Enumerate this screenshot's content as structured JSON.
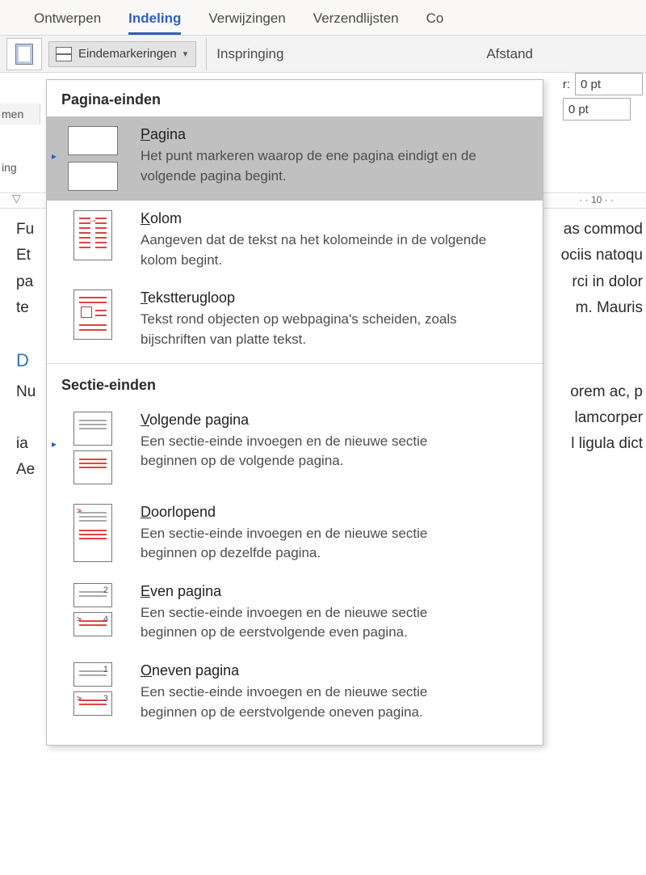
{
  "tabs": {
    "ontwerpen": "Ontwerpen",
    "indeling": "Indeling",
    "verwijzingen": "Verwijzingen",
    "verzendlijsten": "Verzendlijsten",
    "co_fragment": "Co"
  },
  "ribbon": {
    "breaksButton": "Eindemarkeringen",
    "groupIndent": "Inspringing",
    "groupSpacing": "Afstand",
    "spacingLabel": "r:",
    "spacingBefore": "0 pt",
    "spacingAfter": "0 pt",
    "leftFrag1": "men",
    "leftFrag2": "ing"
  },
  "ruler": {
    "tick10": "10"
  },
  "doc": {
    "l1": "Fu",
    "l1r": "as commod",
    "l2": "Et",
    "l2r": "ociis natoqu",
    "l3": "pa",
    "l3r": "rci in dolor",
    "l4": "te",
    "l4r": "m. Mauris",
    "heading": "D",
    "l5": "Nu",
    "l5r": "orem ac, p",
    "l6": "",
    "l6r": "lamcorper",
    "l7": "ia",
    "l7r": "l ligula dict",
    "l8": "Ae"
  },
  "dropdown": {
    "section1": "Pagina-einden",
    "section2": "Sectie-einden",
    "items": {
      "page": {
        "t": "Pagina",
        "tkey": "P",
        "rest": "agina",
        "d": "Het punt markeren waarop de ene pagina eindigt en de volgende pagina begint."
      },
      "column": {
        "t": "Kolom",
        "tkey": "K",
        "rest": "olom",
        "d": "Aangeven dat de tekst na het kolomeinde in de volgende kolom begint."
      },
      "wrap": {
        "t": "Tekstterugloop",
        "tkey": "T",
        "rest": "ekstterugloop",
        "d": "Tekst rond objecten op webpagina's scheiden, zoals bijschriften van platte tekst."
      },
      "next": {
        "t": "Volgende pagina",
        "tkey": "V",
        "rest": "olgende pagina",
        "d": "Een sectie-einde invoegen en de nieuwe sectie beginnen op de volgende pagina."
      },
      "cont": {
        "t": "Doorlopend",
        "tkey": "D",
        "rest": "oorlopend",
        "d": "Een sectie-einde invoegen en de nieuwe sectie beginnen op dezelfde pagina."
      },
      "even": {
        "t": "Even pagina",
        "tkey": "E",
        "rest": "ven pagina",
        "d": "Een sectie-einde invoegen en de nieuwe sectie beginnen op de eerstvolgende even pagina."
      },
      "odd": {
        "t": "Oneven pagina",
        "tkey": "O",
        "rest": "neven pagina",
        "d": "Een sectie-einde invoegen en de nieuwe sectie beginnen op de eerstvolgende oneven pagina."
      }
    }
  }
}
